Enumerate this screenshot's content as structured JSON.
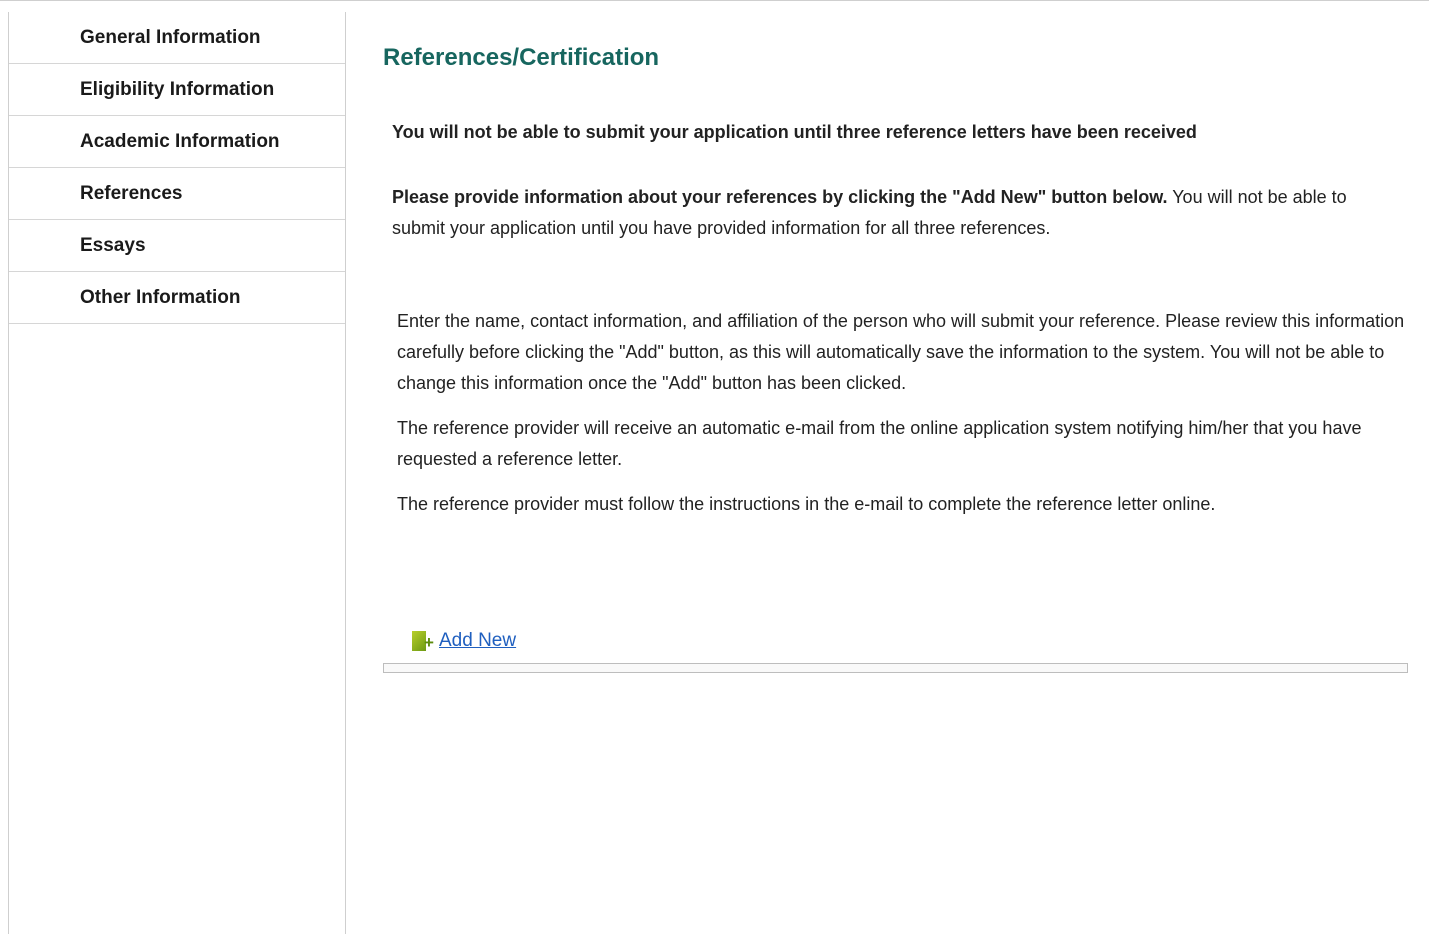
{
  "sidebar": {
    "items": [
      {
        "label": "General Information"
      },
      {
        "label": "Eligibility Information"
      },
      {
        "label": "Academic Information"
      },
      {
        "label": "References"
      },
      {
        "label": "Essays"
      },
      {
        "label": "Other Information"
      }
    ]
  },
  "main": {
    "title": "References/Certification",
    "notice": "You will not be able to submit your application until three reference letters have been received",
    "provide_bold": "Please provide information about your references by clicking the \"Add New\" button below.",
    "provide_rest": " You will not be able to submit your application until you have provided information for all three references.",
    "instructions": [
      "Enter the name, contact information, and affiliation of the person who will submit your reference. Please review this information carefully before clicking the \"Add\" button, as this will automatically save the information to the system. You will not be able to change this information once the \"Add\" button has been clicked.",
      "The reference provider will receive an automatic e-mail from the online application system notifying him/her that you have requested a reference letter.",
      "The reference provider must follow the instructions in the e-mail to complete the reference letter online."
    ],
    "add_new_label": "Add New",
    "add_icon": "add-document-icon"
  },
  "colors": {
    "title": "#17665f",
    "link": "#1f5fbf",
    "border": "#cfcfcf"
  }
}
